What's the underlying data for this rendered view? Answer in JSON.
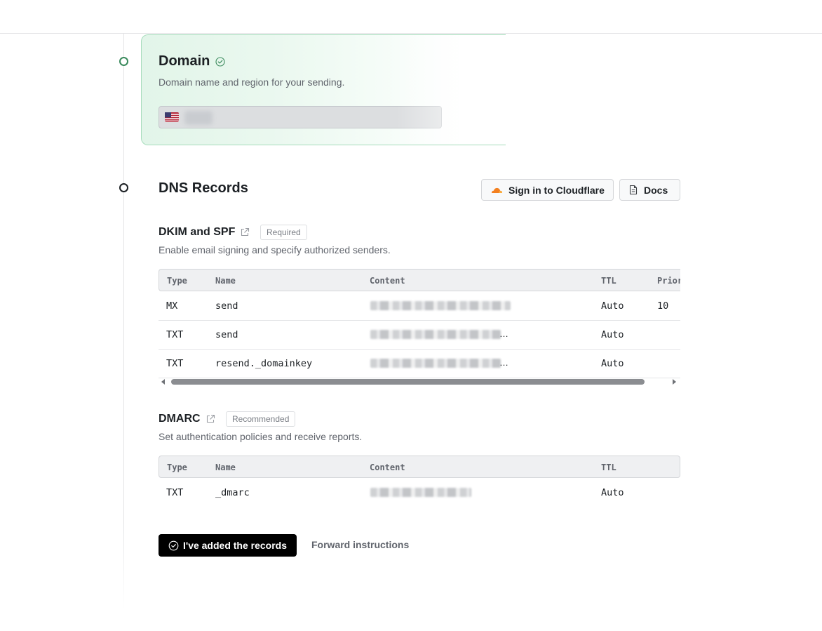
{
  "domain": {
    "title": "Domain",
    "description": "Domain name and region for your sending."
  },
  "dns": {
    "title": "DNS Records",
    "cloudflare_label": "Sign in to Cloudflare",
    "docs_label": "Docs"
  },
  "dkim": {
    "title": "DKIM and SPF",
    "badge": "Required",
    "description": "Enable email signing and specify authorized senders.",
    "headers": [
      "Type",
      "Name",
      "Content",
      "TTL",
      "Priority"
    ],
    "rows": [
      {
        "type": "MX",
        "name": "send",
        "ttl": "Auto",
        "priority": "10"
      },
      {
        "type": "TXT",
        "name": "send",
        "ttl": "Auto",
        "priority": ""
      },
      {
        "type": "TXT",
        "name": "resend._domainkey",
        "ttl": "Auto",
        "priority": ""
      }
    ]
  },
  "dmarc": {
    "title": "DMARC",
    "badge": "Recommended",
    "description": "Set authentication policies and receive reports.",
    "headers": [
      "Type",
      "Name",
      "Content",
      "TTL"
    ],
    "rows": [
      {
        "type": "TXT",
        "name": "_dmarc",
        "ttl": "Auto"
      }
    ]
  },
  "actions": {
    "confirm_label": "I've added the records",
    "forward_label": "Forward instructions"
  },
  "colors": {
    "success": "#3a8a5c",
    "cloudflare": "#f38020",
    "primary_button": "#000000"
  }
}
